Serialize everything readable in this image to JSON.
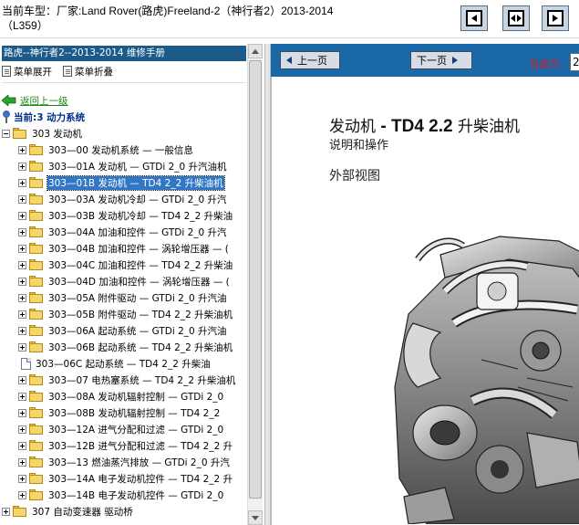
{
  "header": {
    "title_line1": "当前车型：厂家:Land Rover(路虎)Freeland-2（神行者2）2013-2014",
    "title_line2": "（L359）",
    "buttons": [
      "first-page-icon",
      "fit-width-icon",
      "last-page-icon"
    ]
  },
  "sidebar": {
    "manual_title": "路虎--神行者2--2013-2014 维修手册",
    "expand_all": "菜单展开",
    "collapse_all": "菜单折叠",
    "back_link": "返回上一级",
    "current_path": "当前:3 动力系统",
    "root_item": "303 发动机",
    "items": [
      {
        "label": "303—00 发动机系统 — 一般信息",
        "type": "folder"
      },
      {
        "label": "303—01A 发动机 — GTDi 2_0 升汽油机",
        "type": "folder"
      },
      {
        "label": "303—01B 发动机 — TD4 2_2 升柴油机",
        "type": "folder",
        "selected": true
      },
      {
        "label": "303—03A 发动机冷却 — GTDi 2_0 升汽",
        "type": "folder"
      },
      {
        "label": "303—03B 发动机冷却 — TD4 2_2 升柴油",
        "type": "folder"
      },
      {
        "label": "303—04A 加油和控件 — GTDi 2_0 升汽",
        "type": "folder"
      },
      {
        "label": "303—04B 加油和控件 — 涡轮增压器 — (",
        "type": "folder"
      },
      {
        "label": "303—04C 加油和控件 — TD4 2_2 升柴油",
        "type": "folder"
      },
      {
        "label": "303—04D 加油和控件 — 涡轮增压器 — (",
        "type": "folder"
      },
      {
        "label": "303—05A 附件驱动 — GTDi 2_0 升汽油",
        "type": "folder"
      },
      {
        "label": "303—05B 附件驱动 — TD4 2_2 升柴油机",
        "type": "folder"
      },
      {
        "label": "303—06A 起动系统 — GTDi 2_0 升汽油",
        "type": "folder"
      },
      {
        "label": "303—06B 起动系统 — TD4 2_2 升柴油机",
        "type": "folder"
      },
      {
        "label": "303—06C 起动系统 — TD4 2_2 升柴油",
        "type": "doc"
      },
      {
        "label": "303—07 电热塞系统 — TD4 2_2 升柴油机",
        "type": "folder"
      },
      {
        "label": "303—08A 发动机辐射控制 — GTDi 2_0",
        "type": "folder"
      },
      {
        "label": "303—08B 发动机辐射控制 — TD4 2_2",
        "type": "folder"
      },
      {
        "label": "303—12A 进气分配和过滤 — GTDi 2_0",
        "type": "folder"
      },
      {
        "label": "303—12B 进气分配和过滤 — TD4 2_2 升",
        "type": "folder"
      },
      {
        "label": "303—13 燃油蒸汽排放 — GTDi 2_0 升汽",
        "type": "folder"
      },
      {
        "label": "303—14A 电子发动机控件 — TD4 2_2 升",
        "type": "folder"
      },
      {
        "label": "303—14B 电子发动机控件 — GTDi 2_0",
        "type": "folder"
      }
    ],
    "next_root_item": "307 自动变速器 驱动桥"
  },
  "viewer": {
    "prev_label": "上一页",
    "next_label": "下一页",
    "current_label": "当前为",
    "current_value": "2"
  },
  "document": {
    "title_prefix": "发动机",
    "title_bold": "- TD4 2.2",
    "title_suffix": "升柴油机",
    "subtitle": "说明和操作",
    "section": "外部视图",
    "image": "engine-illustration"
  }
}
